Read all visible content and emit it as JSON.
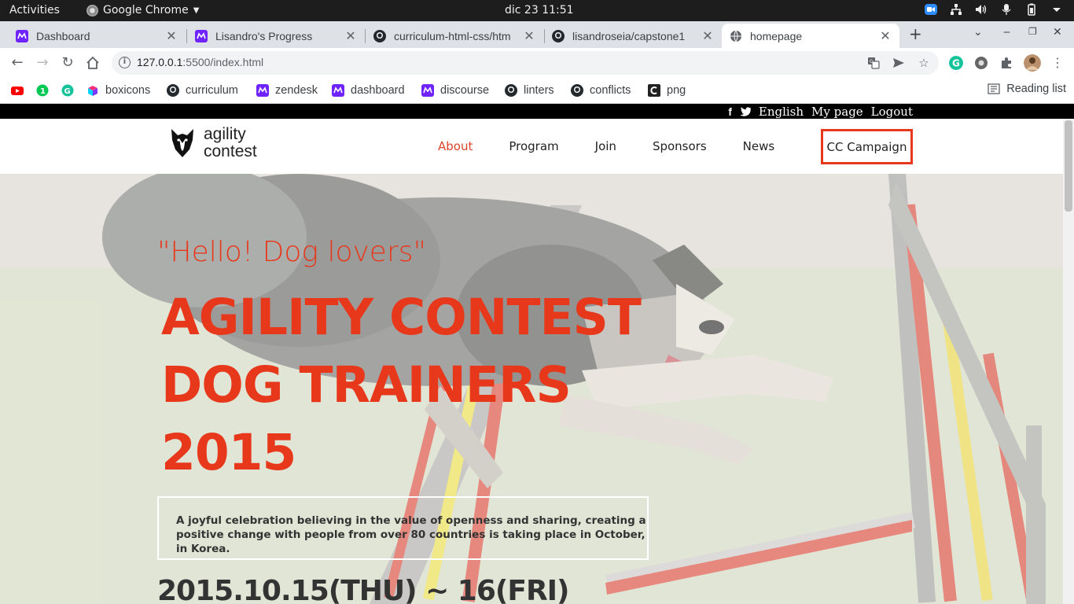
{
  "os": {
    "activities": "Activities",
    "app_name": "Google Chrome",
    "clock": "dic 23  11:51"
  },
  "tabs": [
    {
      "title": "Dashboard",
      "favicon": "microverse-icon",
      "active": false
    },
    {
      "title": "Lisandro's Progress",
      "favicon": "microverse-icon",
      "active": false
    },
    {
      "title": "curriculum-html-css/htm",
      "favicon": "github-icon",
      "active": false
    },
    {
      "title": "lisandroseia/capstone1",
      "favicon": "github-icon",
      "active": false
    },
    {
      "title": "homepage",
      "favicon": "globe-icon",
      "active": true
    }
  ],
  "address_bar": {
    "host": "127.0.0.1",
    "path": ":5500/index.html"
  },
  "bookmarks": [
    {
      "label": "",
      "icon": "youtube-icon"
    },
    {
      "label": "",
      "icon": "green-circle-icon"
    },
    {
      "label": "",
      "icon": "grammarly-icon"
    },
    {
      "label": "boxicons",
      "icon": "boxicons-icon"
    },
    {
      "label": "curriculum",
      "icon": "github-icon"
    },
    {
      "label": "zendesk",
      "icon": "microverse-icon"
    },
    {
      "label": "dashboard",
      "icon": "microverse-icon"
    },
    {
      "label": "discourse",
      "icon": "microverse-icon"
    },
    {
      "label": "linters",
      "icon": "github-icon"
    },
    {
      "label": "conflicts",
      "icon": "github-icon"
    },
    {
      "label": "png",
      "icon": "c-logo-icon"
    }
  ],
  "reading_list": "Reading list",
  "site": {
    "utility": {
      "language": "English",
      "my_page": "My page",
      "logout": "Logout"
    },
    "logo": {
      "line1": "agility",
      "line2": "contest"
    },
    "nav": [
      {
        "label": "About",
        "active": true
      },
      {
        "label": "Program",
        "active": false
      },
      {
        "label": "Join",
        "active": false
      },
      {
        "label": "Sponsors",
        "active": false
      },
      {
        "label": "News",
        "active": false
      }
    ],
    "campaign_button": "CC Campaign",
    "hero": {
      "tagline": "\"Hello! Dog lovers\"",
      "headline_1": "AGILITY CONTEST",
      "headline_2": "DOG TRAINERS",
      "headline_3": "2015",
      "intro": "A joyful celebration believing in the value of openness and sharing, creating a positive change with people from over 80 countries is taking place in October, in Korea.",
      "dates": "2015.10.15(THU) ~ 16(FRI)"
    }
  },
  "colors": {
    "accent": "#e8381c",
    "microverse": "#6f23ff"
  }
}
